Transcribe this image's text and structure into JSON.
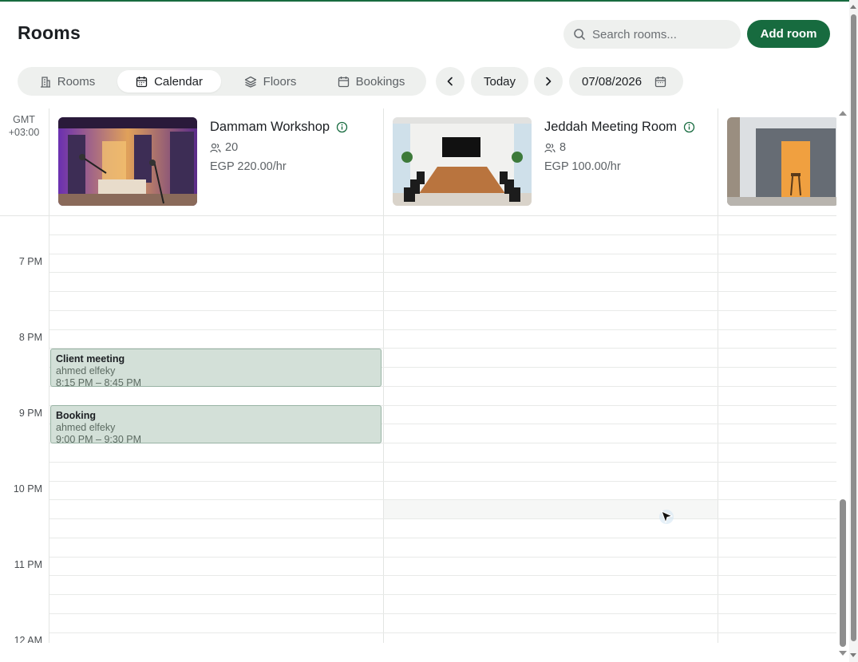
{
  "header": {
    "title": "Rooms",
    "search_placeholder": "Search rooms...",
    "add_button": "Add room"
  },
  "tabs": [
    {
      "label": "Rooms",
      "icon": "building-icon",
      "active": false
    },
    {
      "label": "Calendar",
      "icon": "calendar-icon",
      "active": true
    },
    {
      "label": "Floors",
      "icon": "layers-icon",
      "active": false
    },
    {
      "label": "Bookings",
      "icon": "calendar-icon",
      "active": false
    }
  ],
  "toolbar": {
    "today_label": "Today",
    "date_value": "07/08/2026"
  },
  "calendar": {
    "timezone": "GMT +03:00",
    "timezone_line1": "GMT",
    "timezone_line2": "+03:00",
    "hours": [
      "7 PM",
      "8 PM",
      "9 PM",
      "10 PM",
      "11 PM",
      "12 AM"
    ],
    "rooms": [
      {
        "name": "Dammam Workshop",
        "capacity": "20",
        "price": "EGP 220.00/hr"
      },
      {
        "name": "Jeddah Meeting Room",
        "capacity": "8",
        "price": "EGP 100.00/hr"
      },
      {
        "name": "",
        "capacity": "",
        "price": ""
      }
    ],
    "events": [
      {
        "title": "Client meeting",
        "user": "ahmed elfeky",
        "time": "8:15 PM – 8:45 PM",
        "room": "Dammam Workshop"
      },
      {
        "title": "Booking",
        "user": "ahmed elfeky",
        "time": "9:00 PM – 9:30 PM",
        "room": "Dammam Workshop"
      }
    ]
  },
  "colors": {
    "accent": "#176b3f",
    "event_bg": "#d3e0d8",
    "event_border": "#98b3a4",
    "pill_bg": "#eef0ee"
  }
}
